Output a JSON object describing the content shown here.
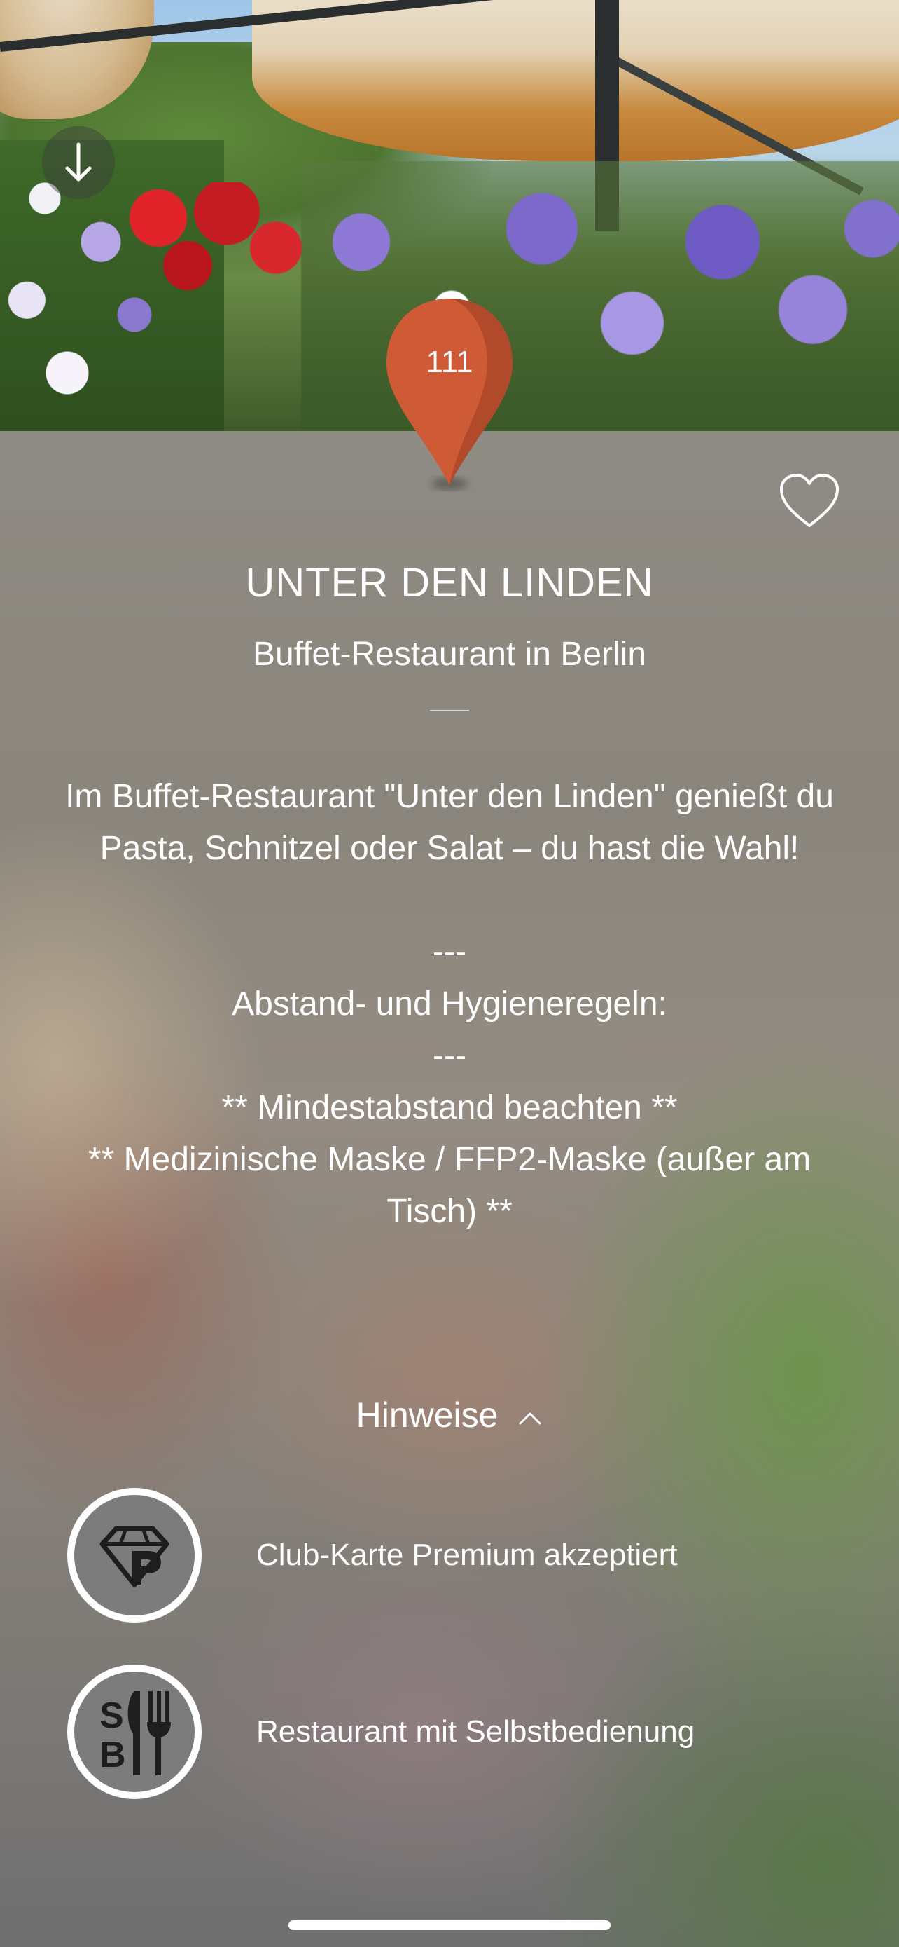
{
  "hero": {
    "download_icon": "arrow-down-icon"
  },
  "pin": {
    "number": "111",
    "color": "#cf5a36"
  },
  "favorite": {
    "icon": "heart-outline-icon"
  },
  "venue": {
    "title": "UNTER DEN LINDEN",
    "subtitle": "Buffet-Restaurant in Berlin",
    "description": "Im Buffet-Restaurant \"Unter den Linden\" genießt du Pasta, Schnitzel oder Salat – du hast die Wahl!\n\n---\nAbstand- und Hygieneregeln:\n---\n** Mindestabstand beachten **\n** Medizinische Maske / FFP2-Maske (außer am Tisch) **"
  },
  "hints": {
    "toggle_label": "Hinweise",
    "toggle_icon": "chevron-up-icon",
    "items": [
      {
        "label": "Club-Karte Premium akzeptiert",
        "icon": "premium-diamond-p-icon"
      },
      {
        "label": "Restaurant mit Selbstbedienung",
        "icon": "self-service-cutlery-icon"
      }
    ]
  }
}
